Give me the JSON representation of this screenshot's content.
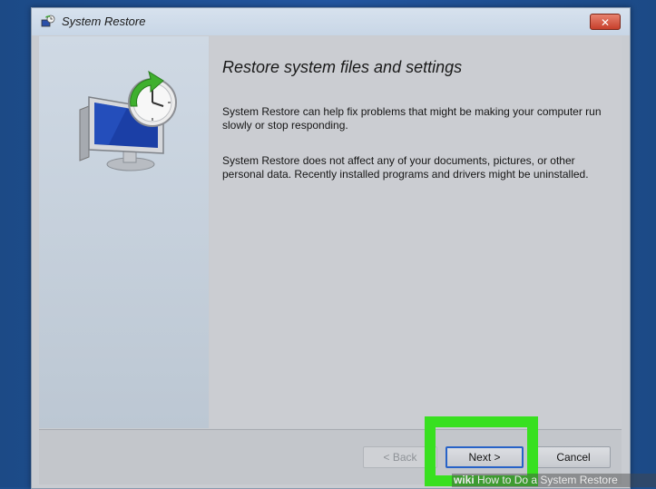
{
  "window": {
    "title": "System Restore",
    "close_glyph": "✕"
  },
  "content": {
    "heading": "Restore system files and settings",
    "paragraph1": "System Restore can help fix problems that might be making your computer run slowly or stop responding.",
    "paragraph2": "System Restore does not affect any of your documents, pictures, or other personal data. Recently installed programs and drivers might be uninstalled."
  },
  "buttons": {
    "back": "< Back",
    "next": "Next >",
    "cancel": "Cancel"
  },
  "watermark": {
    "brand": "wiki",
    "text": "How to Do a System Restore"
  },
  "icons": {
    "title": "system-restore-icon",
    "hero": "computer-clock-restore-icon"
  },
  "colors": {
    "highlight": "#38e020",
    "close_button": "#c7402c",
    "default_button_border": "#2762c7",
    "desktop": "#1f4f8e"
  }
}
